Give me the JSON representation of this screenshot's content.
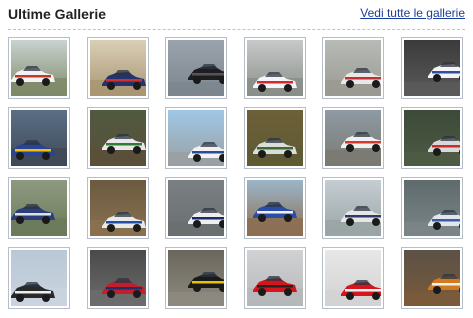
{
  "header": {
    "title": "Ultime Gallerie",
    "view_all_label": "Vedi tutte le gallerie"
  },
  "colors": {
    "link": "#1a3d9c",
    "divider": "#c2c2c2",
    "thumb_border": "#b6bec9"
  },
  "gallery": {
    "thumbnails": [
      {
        "sky": "#c9d2cf",
        "ground": "#7e8a68",
        "car": "#f2f2f2",
        "accent": "#c0392b"
      },
      {
        "sky": "#d9cfb8",
        "ground": "#a99572",
        "car": "#23336e",
        "accent": "#d62d2d"
      },
      {
        "sky": "#9aa3ad",
        "ground": "#7c868e",
        "car": "#1e1e22",
        "accent": "#555555"
      },
      {
        "sky": "#c6c9c8",
        "ground": "#8a8e8a",
        "car": "#f4f4f4",
        "accent": "#d7262e"
      },
      {
        "sky": "#b7bab7",
        "ground": "#9a9a92",
        "car": "#e8e8e8",
        "accent": "#c23030"
      },
      {
        "sky": "#3b3b3b",
        "ground": "#5a5a5a",
        "car": "#f4f4f4",
        "accent": "#2f4fa5"
      },
      {
        "sky": "#5b6e86",
        "ground": "#3e4a57",
        "car": "#27439a",
        "accent": "#f2c200"
      },
      {
        "sky": "#4f5a3f",
        "ground": "#5b4f3a",
        "car": "#e8e8e8",
        "accent": "#2e7d32"
      },
      {
        "sky": "#9fc7e6",
        "ground": "#9aa0a2",
        "car": "#f2f2f2",
        "accent": "#2b4a9a"
      },
      {
        "sky": "#6d6038",
        "ground": "#5e5a34",
        "car": "#dcdcdc",
        "accent": "#3b6d2a"
      },
      {
        "sky": "#8f9aa3",
        "ground": "#7a7a72",
        "car": "#f0f0f0",
        "accent": "#d33a2c"
      },
      {
        "sky": "#3c4a38",
        "ground": "#4d5a44",
        "car": "#d8d8d8",
        "accent": "#c62d2d"
      },
      {
        "sky": "#8e9a80",
        "ground": "#6b7a5a",
        "car": "#2b3e7e",
        "accent": "#e0e0e0"
      },
      {
        "sky": "#6b5a40",
        "ground": "#8a7150",
        "car": "#e9e9e9",
        "accent": "#1f4fa8"
      },
      {
        "sky": "#7a7f82",
        "ground": "#6a6f70",
        "car": "#eeeeee",
        "accent": "#1b2a6b"
      },
      {
        "sky": "#9bb5c8",
        "ground": "#8c6f52",
        "car": "#2a4ea6",
        "accent": "#f0f0f0"
      },
      {
        "sky": "#c5cdd2",
        "ground": "#9aa4a6",
        "car": "#e6e6e6",
        "accent": "#2e3b66"
      },
      {
        "sky": "#5f6a6d",
        "ground": "#7b8587",
        "car": "#dfe6ec",
        "accent": "#3b5aa8"
      },
      {
        "sky": "#b9c8d6",
        "ground": "#c9d4de",
        "car": "#2a2a2a",
        "accent": "#e7eef4"
      },
      {
        "sky": "#4a4a4a",
        "ground": "#6c6c6c",
        "car": "#c11f2c",
        "accent": "#1c2f6e"
      },
      {
        "sky": "#6a665c",
        "ground": "#8d8a80",
        "car": "#1a1a1a",
        "accent": "#e6c200"
      },
      {
        "sky": "#d0d2d4",
        "ground": "#b5b7b9",
        "car": "#d5141c",
        "accent": "#222222"
      },
      {
        "sky": "#e7e7e7",
        "ground": "#d2d2d2",
        "car": "#d9141c",
        "accent": "#f2f2f2"
      },
      {
        "sky": "#5b5146",
        "ground": "#7a5a3a",
        "car": "#d37a1e",
        "accent": "#f0f0f0"
      }
    ]
  }
}
